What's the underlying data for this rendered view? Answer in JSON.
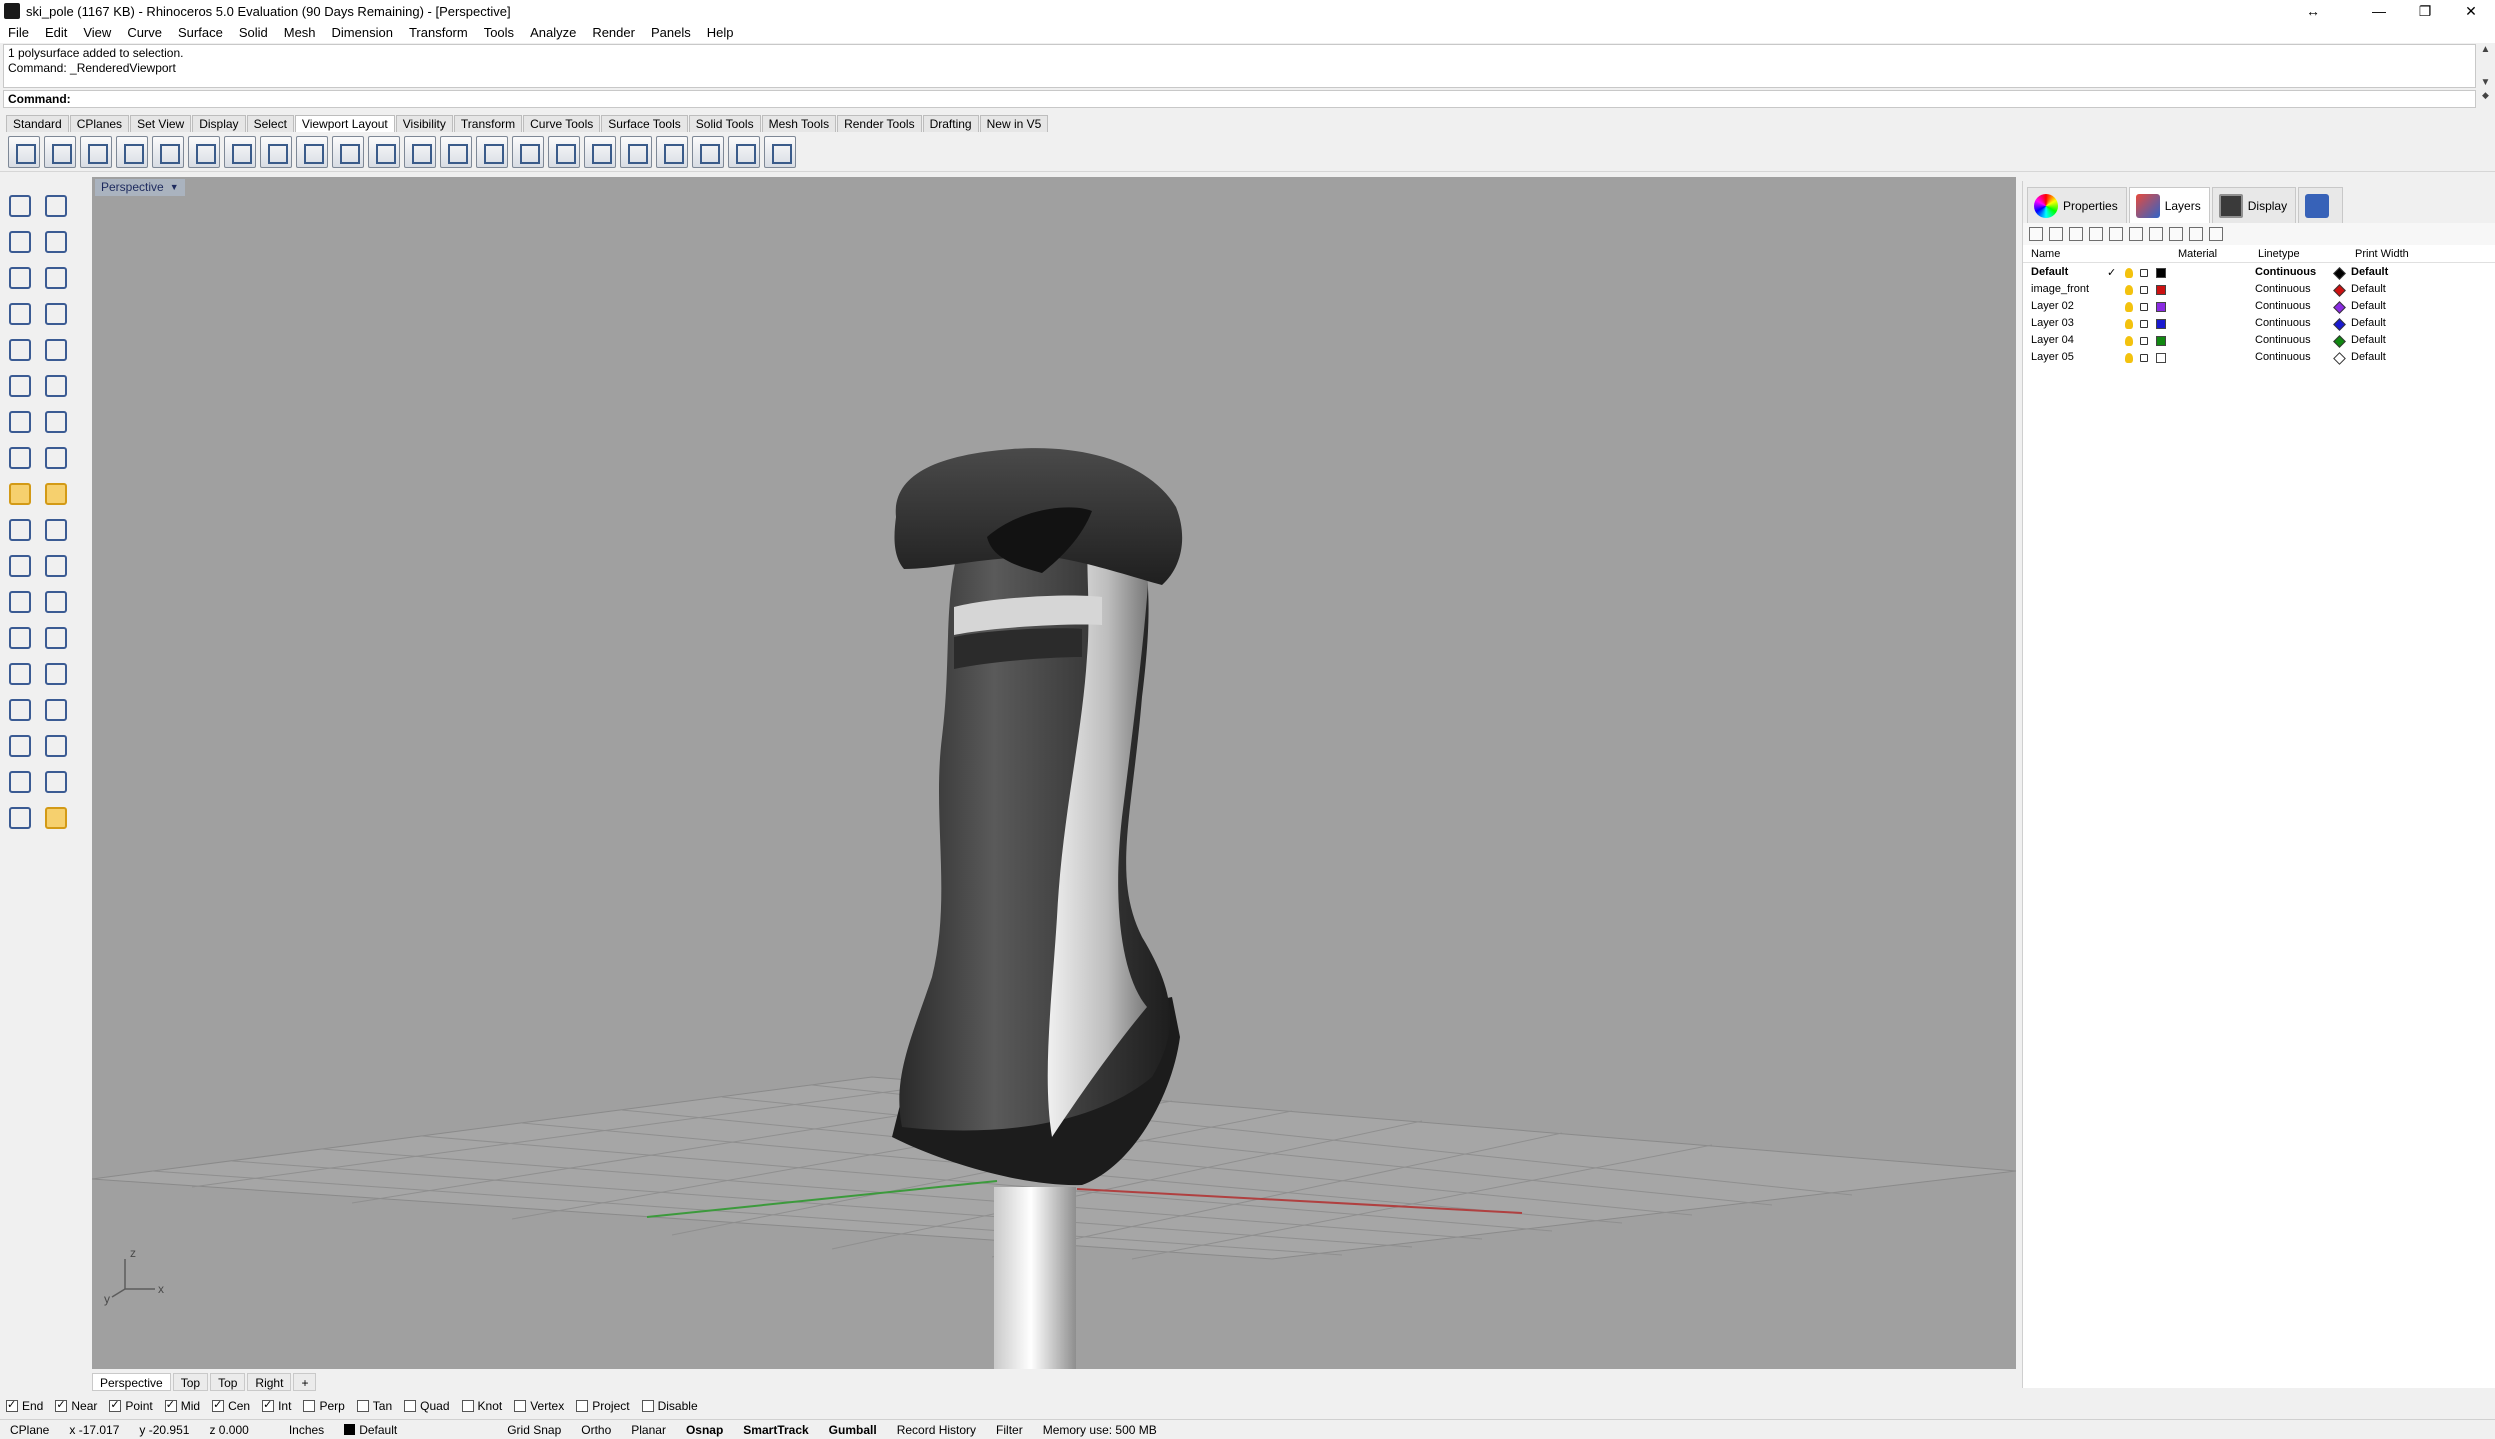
{
  "window": {
    "title": "ski_pole (1167 KB) - Rhinoceros 5.0 Evaluation (90 Days Remaining) - [Perspective]",
    "controls": [
      "↔",
      "—",
      "❐",
      "✕"
    ]
  },
  "menu": [
    "File",
    "Edit",
    "View",
    "Curve",
    "Surface",
    "Solid",
    "Mesh",
    "Dimension",
    "Transform",
    "Tools",
    "Analyze",
    "Render",
    "Panels",
    "Help"
  ],
  "command": {
    "history_line1": "1 polysurface added to selection.",
    "history_line2": "Command: _RenderedViewport",
    "prompt": "Command:"
  },
  "toolbar_tabs": [
    "Standard",
    "CPlanes",
    "Set View",
    "Display",
    "Select",
    "Viewport Layout",
    "Visibility",
    "Transform",
    "Curve Tools",
    "Surface Tools",
    "Solid Tools",
    "Mesh Tools",
    "Render Tools",
    "Drafting",
    "New in V5"
  ],
  "toolbar_active_tab": "Viewport Layout",
  "viewport": {
    "label": "Perspective",
    "axis_z": "z",
    "axis_y": "y",
    "axis_x": "x",
    "colors": {
      "background": "#a0a0a0",
      "grid": "#8d8d8d",
      "x_axis": "#b04040",
      "y_axis": "#3c9a3c"
    }
  },
  "viewport_tabs": [
    "Perspective",
    "Top",
    "Top",
    "Right",
    "+"
  ],
  "panel": {
    "tabs": [
      "Properties",
      "Layers",
      "Display"
    ],
    "active_tab": "Layers",
    "headers": {
      "name": "Name",
      "material": "Material",
      "linetype": "Linetype",
      "print_width": "Print Width"
    },
    "layers": [
      {
        "name": "Default",
        "current": "✓",
        "color": "#000000",
        "linetype": "Continuous",
        "print_width": "Default",
        "bold": true
      },
      {
        "name": "image_front",
        "current": "",
        "color": "#cc1111",
        "linetype": "Continuous",
        "print_width": "Default",
        "bold": false
      },
      {
        "name": "Layer 02",
        "current": "",
        "color": "#8a2be2",
        "linetype": "Continuous",
        "print_width": "Default",
        "bold": false
      },
      {
        "name": "Layer 03",
        "current": "",
        "color": "#1a1ad0",
        "linetype": "Continuous",
        "print_width": "Default",
        "bold": false
      },
      {
        "name": "Layer 04",
        "current": "",
        "color": "#118811",
        "linetype": "Continuous",
        "print_width": "Default",
        "bold": false
      },
      {
        "name": "Layer 05",
        "current": "",
        "color": "#ffffff",
        "linetype": "Continuous",
        "print_width": "Default",
        "bold": false
      }
    ]
  },
  "osnaps": [
    {
      "label": "End",
      "checked": true
    },
    {
      "label": "Near",
      "checked": true
    },
    {
      "label": "Point",
      "checked": true
    },
    {
      "label": "Mid",
      "checked": true
    },
    {
      "label": "Cen",
      "checked": true
    },
    {
      "label": "Int",
      "checked": true
    },
    {
      "label": "Perp",
      "checked": false
    },
    {
      "label": "Tan",
      "checked": false
    },
    {
      "label": "Quad",
      "checked": false
    },
    {
      "label": "Knot",
      "checked": false
    },
    {
      "label": "Vertex",
      "checked": false
    },
    {
      "label": "Project",
      "checked": false
    },
    {
      "label": "Disable",
      "checked": false
    }
  ],
  "status": {
    "cplane": "CPlane",
    "x": "x -17.017",
    "y": "y -20.951",
    "z": "z 0.000",
    "units": "Inches",
    "layer": "Default",
    "grid_snap": "Grid Snap",
    "ortho": "Ortho",
    "planar": "Planar",
    "osnap": "Osnap",
    "smarttrack": "SmartTrack",
    "gumball": "Gumball",
    "record_history": "Record History",
    "filter": "Filter",
    "memory": "Memory use: 500 MB"
  }
}
